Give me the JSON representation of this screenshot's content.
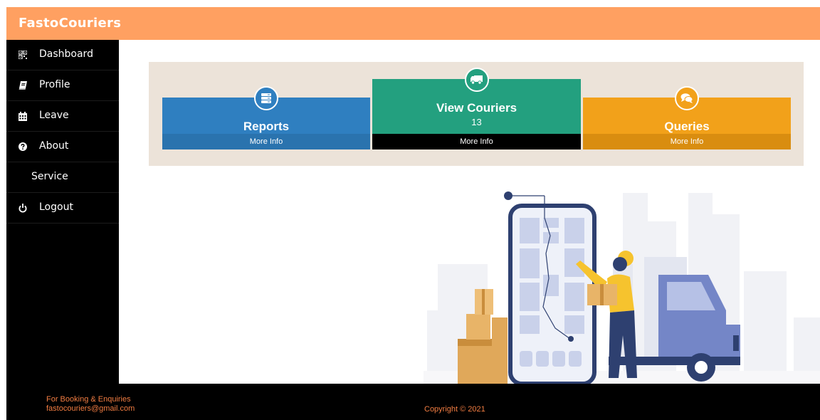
{
  "header": {
    "brand": "FastoCouriers"
  },
  "sidebar": {
    "items": [
      {
        "label": "Dashboard",
        "icon": "qrcode-icon"
      },
      {
        "label": "Profile",
        "icon": "book-icon"
      },
      {
        "label": "Leave",
        "icon": "calendar-icon"
      },
      {
        "label": "About",
        "icon": "question-circle-icon"
      },
      {
        "label": "Service",
        "icon": ""
      },
      {
        "label": "Logout",
        "icon": "power-icon"
      }
    ]
  },
  "cards": [
    {
      "title": "Reports",
      "count": "",
      "more": "More Info",
      "icon": "server-icon",
      "color": "#2f7fc0"
    },
    {
      "title": "View Couriers",
      "count": "13",
      "more": "More Info",
      "icon": "truck-icon",
      "color": "#23a07f"
    },
    {
      "title": "Queries",
      "count": "",
      "more": "More Info",
      "icon": "comments-icon",
      "color": "#f2a11a"
    }
  ],
  "footer": {
    "booking_line1": "For Booking & Enquiries",
    "booking_line2": "fastocouriers@gmail.com",
    "copyright": "Copyright © 2021"
  },
  "colors": {
    "topbar": "#ffa061",
    "sidebar": "#000000",
    "footer_text": "#f27d42",
    "panel": "#ece3d9"
  }
}
